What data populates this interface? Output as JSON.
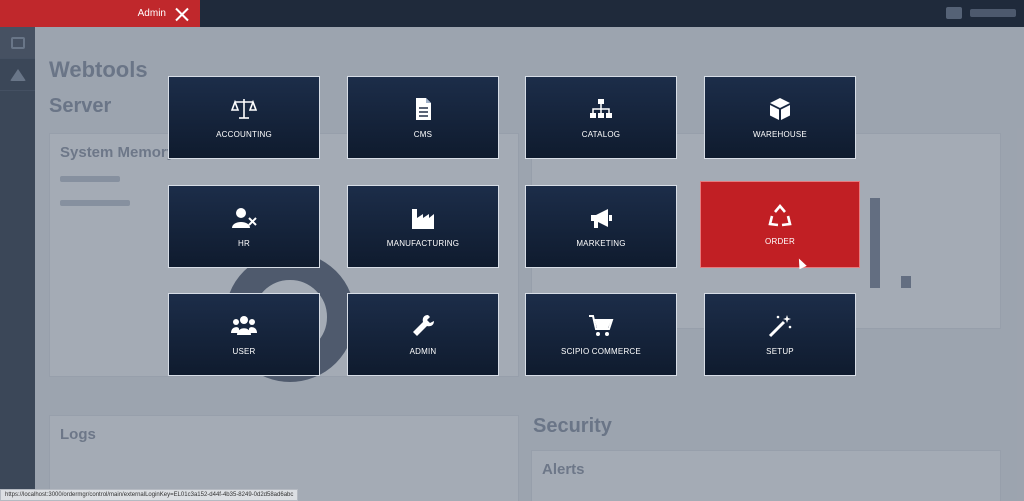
{
  "topbar": {
    "app_label": "Admin"
  },
  "dashboard": {
    "title": "Webtools",
    "subtitle": "Server",
    "memory_panel_title": "System Memory",
    "logs_title": "Logs",
    "security_title": "Security",
    "alerts_title": "Alerts"
  },
  "tiles": [
    {
      "label": "ACCOUNTING",
      "icon": "balance-scale-icon"
    },
    {
      "label": "CMS",
      "icon": "document-icon"
    },
    {
      "label": "CATALOG",
      "icon": "sitemap-icon"
    },
    {
      "label": "WAREHOUSE",
      "icon": "cube-icon"
    },
    {
      "label": "HR",
      "icon": "user-remove-icon"
    },
    {
      "label": "MANUFACTURING",
      "icon": "factory-icon"
    },
    {
      "label": "MARKETING",
      "icon": "megaphone-icon"
    },
    {
      "label": "ORDER",
      "icon": "recycle-icon"
    },
    {
      "label": "USER",
      "icon": "users-icon"
    },
    {
      "label": "ADMIN",
      "icon": "wrench-icon"
    },
    {
      "label": "SCIPIO COMMERCE",
      "icon": "cart-icon"
    },
    {
      "label": "SETUP",
      "icon": "magic-wand-icon"
    }
  ],
  "active_tile": "ORDER",
  "colors": {
    "topbar": "#1f2a3b",
    "accent": "#c0282c",
    "tile": "#13223a"
  },
  "status_url": "https://localhost:3000/ordermgr/control/main/externalLoginKey=EL01c3a152-d44f-4b35-8249-0d2d58ad6abc"
}
